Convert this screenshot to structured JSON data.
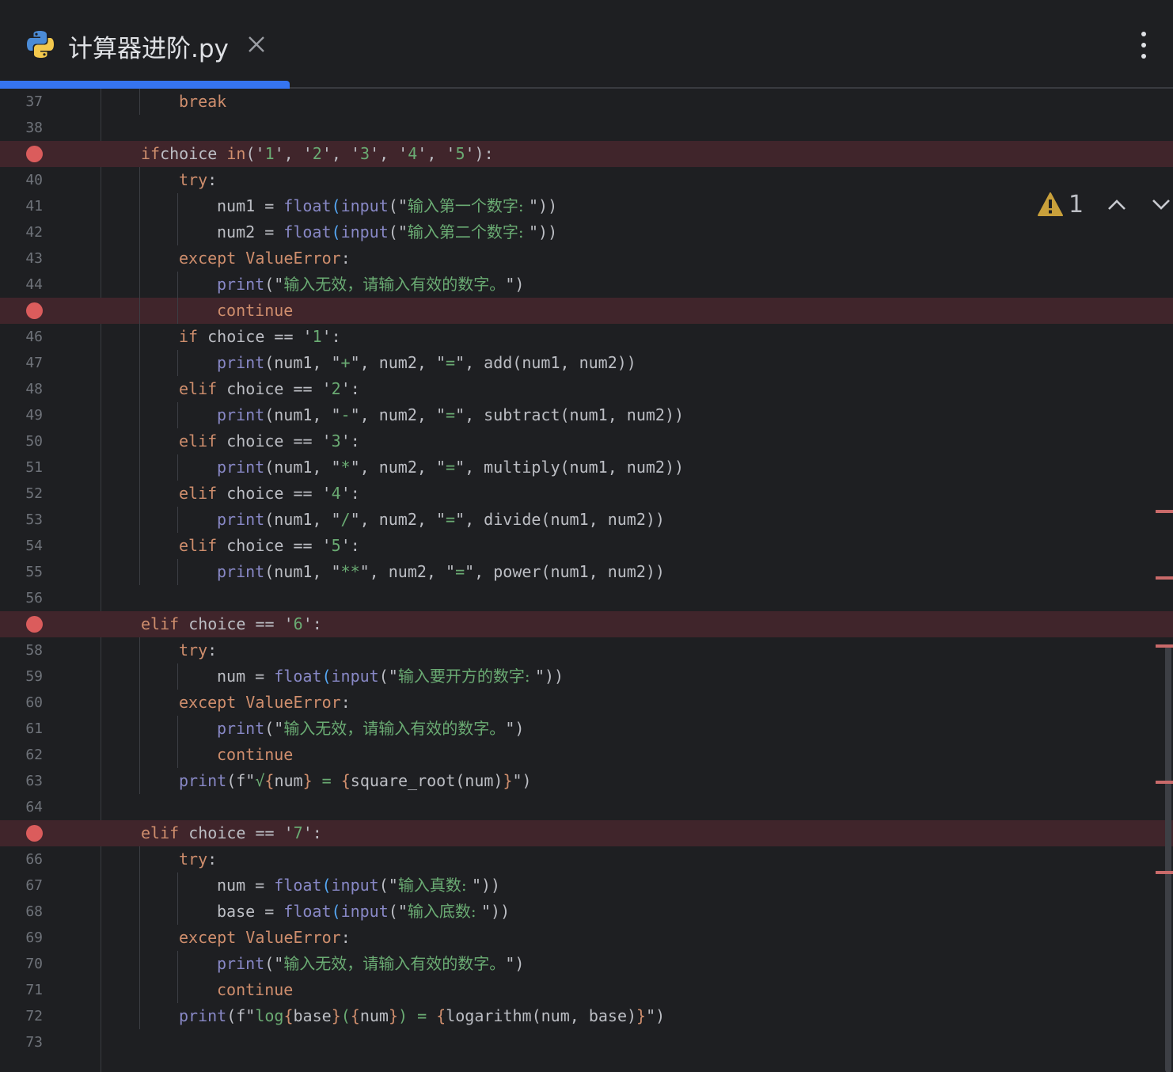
{
  "tab": {
    "title": "计算器进阶.py",
    "icon": "python-file-icon",
    "active_color": "#3574f0"
  },
  "inspection": {
    "warning_count": "1"
  },
  "colors": {
    "keyword": "#cf8e6d",
    "function": "#56a8f5",
    "builtin": "#8888c6",
    "string": "#6aab73",
    "breakpoint": "#db5c5c",
    "breakpoint_line": "#40252b"
  },
  "lines": [
    {
      "num": "37",
      "indent": 2,
      "bp": false,
      "tokens": [
        [
          "kw",
          "break"
        ]
      ]
    },
    {
      "num": "38",
      "indent": 0,
      "bp": false,
      "tokens": []
    },
    {
      "num": "39",
      "indent": 1,
      "bp": true,
      "tokens": [
        [
          "kw",
          "if"
        ],
        [
          "",
          "choice "
        ],
        [
          "kw",
          "in"
        ],
        [
          "",
          ""
        ],
        [
          "",
          "('"
        ],
        [
          "st",
          "1"
        ],
        [
          "",
          "', '"
        ],
        [
          "st",
          "2"
        ],
        [
          "",
          "', '"
        ],
        [
          "st",
          "3"
        ],
        [
          "",
          "', '"
        ],
        [
          "st",
          "4"
        ],
        [
          "",
          "', '"
        ],
        [
          "st",
          "5"
        ],
        [
          "",
          "'):"
        ]
      ]
    },
    {
      "num": "40",
      "indent": 2,
      "bp": false,
      "tokens": [
        [
          "kw",
          "try"
        ],
        [
          "",
          ":"
        ]
      ]
    },
    {
      "num": "41",
      "indent": 3,
      "bp": false,
      "tokens": [
        [
          "",
          "num1 = "
        ],
        [
          "bi",
          "float"
        ],
        [
          "fn",
          "("
        ],
        [
          "bi",
          "input"
        ],
        [
          "",
          "(\""
        ],
        [
          "st",
          "输入第一个数字: "
        ],
        [
          "",
          "\"))"
        ]
      ]
    },
    {
      "num": "42",
      "indent": 3,
      "bp": false,
      "tokens": [
        [
          "",
          "num2 = "
        ],
        [
          "bi",
          "float"
        ],
        [
          "fn",
          "("
        ],
        [
          "bi",
          "input"
        ],
        [
          "",
          "(\""
        ],
        [
          "st",
          "输入第二个数字: "
        ],
        [
          "",
          "\"))"
        ]
      ]
    },
    {
      "num": "43",
      "indent": 2,
      "bp": false,
      "tokens": [
        [
          "kw",
          "except "
        ],
        [
          "cls",
          "ValueError"
        ],
        [
          "",
          ":"
        ]
      ]
    },
    {
      "num": "44",
      "indent": 3,
      "bp": false,
      "tokens": [
        [
          "bi",
          "print"
        ],
        [
          "",
          "(\""
        ],
        [
          "st",
          "输入无效，请输入有效的数字。"
        ],
        [
          "",
          "\")"
        ]
      ]
    },
    {
      "num": "45",
      "indent": 3,
      "bp": true,
      "tokens": [
        [
          "kw",
          "continue"
        ]
      ]
    },
    {
      "num": "46",
      "indent": 2,
      "bp": false,
      "tokens": [
        [
          "kw",
          "if"
        ],
        [
          "",
          " choice == '"
        ],
        [
          "st",
          "1"
        ],
        [
          "",
          "':"
        ]
      ]
    },
    {
      "num": "47",
      "indent": 3,
      "bp": false,
      "tokens": [
        [
          "bi",
          "print"
        ],
        [
          "",
          "(num1, \""
        ],
        [
          "st",
          "+"
        ],
        [
          "",
          "\", num2, \""
        ],
        [
          "st",
          "="
        ],
        [
          "",
          "\", add(num1, num2))"
        ]
      ]
    },
    {
      "num": "48",
      "indent": 2,
      "bp": false,
      "tokens": [
        [
          "kw",
          "elif"
        ],
        [
          "",
          " choice == '"
        ],
        [
          "st",
          "2"
        ],
        [
          "",
          "':"
        ]
      ]
    },
    {
      "num": "49",
      "indent": 3,
      "bp": false,
      "tokens": [
        [
          "bi",
          "print"
        ],
        [
          "",
          "(num1, \""
        ],
        [
          "st",
          "-"
        ],
        [
          "",
          "\", num2, \""
        ],
        [
          "st",
          "="
        ],
        [
          "",
          "\", subtract(num1, num2))"
        ]
      ]
    },
    {
      "num": "50",
      "indent": 2,
      "bp": false,
      "tokens": [
        [
          "kw",
          "elif"
        ],
        [
          "",
          " choice == '"
        ],
        [
          "st",
          "3"
        ],
        [
          "",
          "':"
        ]
      ]
    },
    {
      "num": "51",
      "indent": 3,
      "bp": false,
      "tokens": [
        [
          "bi",
          "print"
        ],
        [
          "",
          "(num1, \""
        ],
        [
          "st",
          "*"
        ],
        [
          "",
          "\", num2, \""
        ],
        [
          "st",
          "="
        ],
        [
          "",
          "\", multiply(num1, num2))"
        ]
      ]
    },
    {
      "num": "52",
      "indent": 2,
      "bp": false,
      "tokens": [
        [
          "kw",
          "elif"
        ],
        [
          "",
          " choice == '"
        ],
        [
          "st",
          "4"
        ],
        [
          "",
          "':"
        ]
      ]
    },
    {
      "num": "53",
      "indent": 3,
      "bp": false,
      "tokens": [
        [
          "bi",
          "print"
        ],
        [
          "",
          "(num1, \""
        ],
        [
          "st",
          "/"
        ],
        [
          "",
          "\", num2, \""
        ],
        [
          "st",
          "="
        ],
        [
          "",
          "\", divide(num1, num2))"
        ]
      ]
    },
    {
      "num": "54",
      "indent": 2,
      "bp": false,
      "tokens": [
        [
          "kw",
          "elif"
        ],
        [
          "",
          " choice == '"
        ],
        [
          "st",
          "5"
        ],
        [
          "",
          "':"
        ]
      ]
    },
    {
      "num": "55",
      "indent": 3,
      "bp": false,
      "tokens": [
        [
          "bi",
          "print"
        ],
        [
          "",
          "(num1, \""
        ],
        [
          "st",
          "**"
        ],
        [
          "",
          "\", num2, \""
        ],
        [
          "st",
          "="
        ],
        [
          "",
          "\", power(num1, num2))"
        ]
      ]
    },
    {
      "num": "56",
      "indent": 0,
      "bp": false,
      "tokens": []
    },
    {
      "num": "57",
      "indent": 1,
      "bp": true,
      "tokens": [
        [
          "kw",
          "elif"
        ],
        [
          "",
          " choice == '"
        ],
        [
          "st",
          "6"
        ],
        [
          "",
          "':"
        ]
      ]
    },
    {
      "num": "58",
      "indent": 2,
      "bp": false,
      "tokens": [
        [
          "kw",
          "try"
        ],
        [
          "",
          ":"
        ]
      ]
    },
    {
      "num": "59",
      "indent": 3,
      "bp": false,
      "tokens": [
        [
          "",
          "num = "
        ],
        [
          "bi",
          "float"
        ],
        [
          "fn",
          "("
        ],
        [
          "bi",
          "input"
        ],
        [
          "",
          "(\""
        ],
        [
          "st",
          "输入要开方的数字: "
        ],
        [
          "",
          "\"))"
        ]
      ]
    },
    {
      "num": "60",
      "indent": 2,
      "bp": false,
      "tokens": [
        [
          "kw",
          "except "
        ],
        [
          "cls",
          "ValueError"
        ],
        [
          "",
          ":"
        ]
      ]
    },
    {
      "num": "61",
      "indent": 3,
      "bp": false,
      "tokens": [
        [
          "bi",
          "print"
        ],
        [
          "",
          "(\""
        ],
        [
          "st",
          "输入无效，请输入有效的数字。"
        ],
        [
          "",
          "\")"
        ]
      ]
    },
    {
      "num": "62",
      "indent": 3,
      "bp": false,
      "tokens": [
        [
          "kw",
          "continue"
        ]
      ]
    },
    {
      "num": "63",
      "indent": 2,
      "bp": false,
      "tokens": [
        [
          "bi",
          "print"
        ],
        [
          "",
          "(f\""
        ],
        [
          "st",
          "√"
        ],
        [
          "kw",
          "{"
        ],
        [
          "",
          "num"
        ],
        [
          "kw",
          "}"
        ],
        [
          "st",
          " = "
        ],
        [
          "kw",
          "{"
        ],
        [
          "",
          "square_root(num)"
        ],
        [
          "kw",
          "}"
        ],
        [
          "",
          "\")"
        ]
      ]
    },
    {
      "num": "64",
      "indent": 0,
      "bp": false,
      "tokens": []
    },
    {
      "num": "65",
      "indent": 1,
      "bp": true,
      "tokens": [
        [
          "kw",
          "elif"
        ],
        [
          "",
          " choice == '"
        ],
        [
          "st",
          "7"
        ],
        [
          "",
          "':"
        ]
      ]
    },
    {
      "num": "66",
      "indent": 2,
      "bp": false,
      "tokens": [
        [
          "kw",
          "try"
        ],
        [
          "",
          ":"
        ]
      ]
    },
    {
      "num": "67",
      "indent": 3,
      "bp": false,
      "tokens": [
        [
          "",
          "num = "
        ],
        [
          "bi",
          "float"
        ],
        [
          "fn",
          "("
        ],
        [
          "bi",
          "input"
        ],
        [
          "",
          "(\""
        ],
        [
          "st",
          "输入真数: "
        ],
        [
          "",
          "\"))"
        ]
      ]
    },
    {
      "num": "68",
      "indent": 3,
      "bp": false,
      "tokens": [
        [
          "",
          "base = "
        ],
        [
          "bi",
          "float"
        ],
        [
          "fn",
          "("
        ],
        [
          "bi",
          "input"
        ],
        [
          "",
          "(\""
        ],
        [
          "st",
          "输入底数: "
        ],
        [
          "",
          "\"))"
        ]
      ]
    },
    {
      "num": "69",
      "indent": 2,
      "bp": false,
      "tokens": [
        [
          "kw",
          "except "
        ],
        [
          "cls",
          "ValueError"
        ],
        [
          "",
          ":"
        ]
      ]
    },
    {
      "num": "70",
      "indent": 3,
      "bp": false,
      "tokens": [
        [
          "bi",
          "print"
        ],
        [
          "",
          "(\""
        ],
        [
          "st",
          "输入无效，请输入有效的数字。"
        ],
        [
          "",
          "\")"
        ]
      ]
    },
    {
      "num": "71",
      "indent": 3,
      "bp": false,
      "tokens": [
        [
          "kw",
          "continue"
        ]
      ]
    },
    {
      "num": "72",
      "indent": 2,
      "bp": false,
      "tokens": [
        [
          "bi",
          "print"
        ],
        [
          "",
          "(f\""
        ],
        [
          "st",
          "log"
        ],
        [
          "kw",
          "{"
        ],
        [
          "",
          "base"
        ],
        [
          "kw",
          "}"
        ],
        [
          "st",
          "("
        ],
        [
          "kw",
          "{"
        ],
        [
          "",
          "num"
        ],
        [
          "kw",
          "}"
        ],
        [
          "st",
          ") = "
        ],
        [
          "kw",
          "{"
        ],
        [
          "",
          "logarithm(num, base)"
        ],
        [
          "kw",
          "}"
        ],
        [
          "",
          "\")"
        ]
      ]
    },
    {
      "num": "73",
      "indent": 0,
      "bp": false,
      "tokens": []
    }
  ]
}
